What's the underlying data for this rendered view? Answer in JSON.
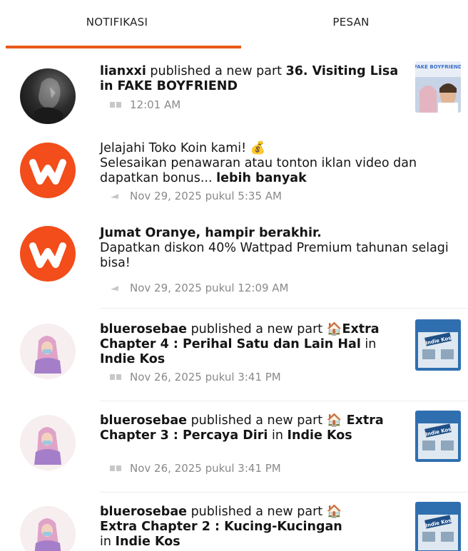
{
  "tabs": {
    "notifications": "NOTIFIKASI",
    "messages": "PESAN"
  },
  "colors": {
    "accent": "#e85a19",
    "wattpad_orange": "#f24d1a",
    "muted": "#8a8a8a"
  },
  "notifications": [
    {
      "avatar": "user-avatar-dark",
      "user": "lianxxi",
      "action": " published a new part ",
      "title": "36. Visiting Lisa in FAKE BOYFRIEND",
      "time_icon": "book-icon",
      "time": "12:01 AM",
      "thumb": "FAKE BOYFRIEND"
    },
    {
      "avatar": "wattpad-logo",
      "line1": "Jelajahi Toko Koin kami! ",
      "emoji": "💰",
      "line2": "Selesaikan penawaran atau tonton iklan video dan dapatkan bonus... ",
      "more": "lebih banyak",
      "time_icon": "megaphone-icon",
      "time": "Nov 29, 2025 pukul 5:35 AM"
    },
    {
      "avatar": "wattpad-logo",
      "title": "Jumat Oranye, hampir berakhir.",
      "body": "Dapatkan diskon 40% Wattpad Premium tahunan selagi bisa!",
      "time_icon": "megaphone-icon",
      "time": "Nov 29, 2025 pukul 12:09 AM"
    },
    {
      "avatar": "user-avatar-hijab",
      "user": "bluerosebae",
      "action": " published a new part ",
      "emoji": "🏠",
      "title": "Extra Chapter 4 : Perihal Satu dan Lain Hal",
      "in": " in ",
      "story": "Indie Kos",
      "time_icon": "book-icon",
      "time": "Nov 26, 2025 pukul 3:41 PM",
      "thumb": "Indie Kos"
    },
    {
      "avatar": "user-avatar-hijab",
      "user": "bluerosebae",
      "action": " published a new part ",
      "emoji": "🏠",
      "title": " Extra Chapter 3 : Percaya Diri",
      "in": " in ",
      "story": "Indie Kos",
      "time_icon": "book-icon",
      "time": "Nov 26, 2025 pukul 3:41 PM",
      "thumb": "Indie Kos"
    },
    {
      "avatar": "user-avatar-hijab",
      "user": "bluerosebae",
      "action": " published a new part ",
      "emoji": "🏠",
      "title": " Extra Chapter 2 : Kucing-Kucingan",
      "in": " in ",
      "story": "Indie Kos",
      "thumb": "Indie Kos"
    }
  ]
}
